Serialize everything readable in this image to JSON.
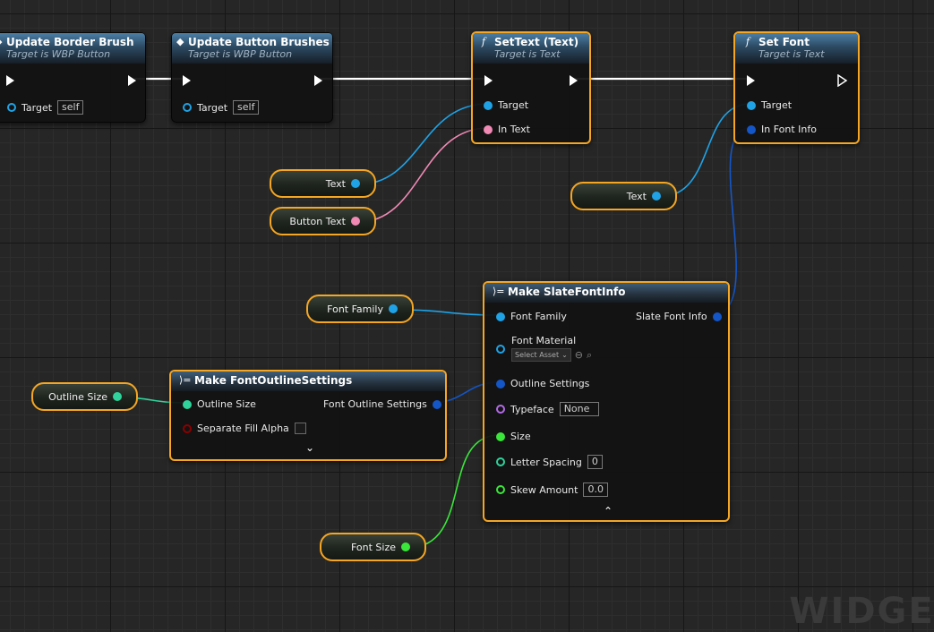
{
  "nodes": {
    "update_border": {
      "title": "Update Border Brush",
      "subtitle": "Target is WBP Button",
      "target_label": "Target",
      "target_value": "self"
    },
    "update_button": {
      "title": "Update Button Brushes",
      "subtitle": "Target is WBP Button",
      "target_label": "Target",
      "target_value": "self"
    },
    "settext": {
      "title": "SetText (Text)",
      "subtitle": "Target is Text",
      "target_label": "Target",
      "intext_label": "In Text"
    },
    "setfont": {
      "title": "Set Font",
      "subtitle": "Target is Text",
      "target_label": "Target",
      "fontinfo_label": "In Font Info"
    },
    "make_slate": {
      "title": "Make SlateFontInfo",
      "font_family": "Font Family",
      "output": "Slate Font Info",
      "font_material": "Font Material",
      "select_asset": "Select Asset",
      "outline_settings": "Outline Settings",
      "typeface": "Typeface",
      "typeface_value": "None",
      "size": "Size",
      "letter_spacing": "Letter Spacing",
      "letter_spacing_value": "0",
      "skew_amount": "Skew Amount",
      "skew_amount_value": "0.0"
    },
    "make_outline": {
      "title": "Make FontOutlineSettings",
      "outline_size": "Outline Size",
      "output": "Font Outline Settings",
      "separate_fill_alpha": "Separate Fill Alpha"
    }
  },
  "variables": {
    "text_a": "Text",
    "button_text": "Button Text",
    "text_b": "Text",
    "font_family": "Font Family",
    "outline_size": "Outline Size",
    "font_size": "Font Size"
  },
  "colors": {
    "exec": "#ffffff",
    "object": "#1fa3e6",
    "text": "#f089b4",
    "struct": "#1456c8",
    "float": "#2fd39b",
    "int": "#3be63b",
    "bool": "#8b0000",
    "typeface": "#b36be6",
    "selection": "#f5a623"
  },
  "watermark": "WIDGET"
}
